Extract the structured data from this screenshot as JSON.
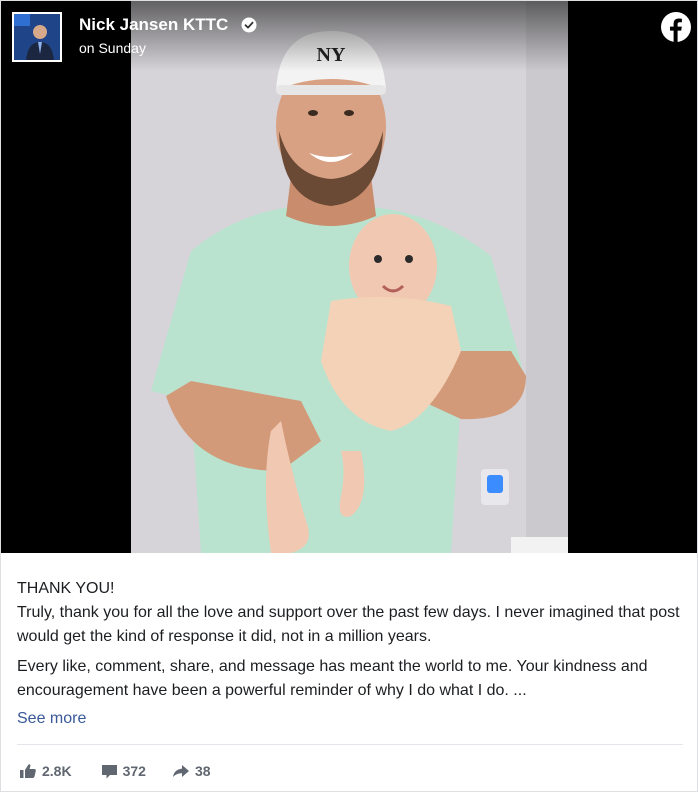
{
  "post": {
    "author": {
      "name": "Nick Jansen KTTC",
      "verified_icon": "verified-check-icon",
      "avatar_icon": "avatar"
    },
    "timestamp": "on Sunday",
    "platform_icon": "facebook-logo-icon",
    "media": {
      "type": "photo"
    },
    "text": {
      "line1": "THANK YOU!",
      "paragraph1": "Truly, thank you for all the love and support over the past few days. I never imagined that post would get the kind of response it did, not in a million years.",
      "paragraph2": "Every like, comment, share, and message has meant the world to me. Your kindness and encouragement have been a powerful reminder of why I do what I do. ...",
      "see_more": "See more"
    },
    "stats": {
      "likes": "2.8K",
      "comments": "372",
      "shares": "38"
    }
  },
  "colors": {
    "link": "#385898",
    "muted": "#606770",
    "text": "#1c1e21",
    "divider": "#e4e6eb",
    "facebook_logo": "#ffffff"
  }
}
